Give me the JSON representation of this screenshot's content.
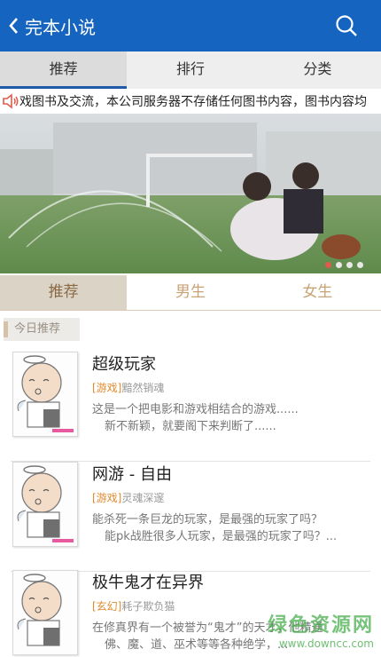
{
  "header": {
    "title": "完本小说",
    "back_icon": "chevron-left-icon",
    "search_icon": "search-icon",
    "bg_color": "#1565c0"
  },
  "main_tabs": [
    {
      "label": "推荐",
      "active": true
    },
    {
      "label": "排行",
      "active": false
    },
    {
      "label": "分类",
      "active": false
    }
  ],
  "notice": {
    "icon": "speaker-icon",
    "text": "戏图书及交流，本公司服务器不存储任何图书内容，图书内容均"
  },
  "banner": {
    "slide_count": 4,
    "active_slide": 1
  },
  "sub_tabs": [
    {
      "label": "推荐",
      "active": true
    },
    {
      "label": "男生",
      "active": false
    },
    {
      "label": "女生",
      "active": false
    }
  ],
  "section": {
    "label": "今日推荐"
  },
  "books": [
    {
      "title": "超级玩家",
      "genre": "[游戏]",
      "author": "黯然销魂",
      "desc1": "这是一个把电影和游戏相结合的游戏......",
      "desc2": "新不新颖，就要阁下来判断了......"
    },
    {
      "title": "网游 - 自由",
      "genre": "[游戏]",
      "author": "灵魂深邃",
      "desc1": "能杀死一条巨龙的玩家，是最强的玩家了吗？",
      "desc2": "能pk战胜很多人玩家，是最强的玩家了吗？..."
    },
    {
      "title": "极牛鬼才在异界",
      "genre": "[玄幻]",
      "author": "耗子欺负猫",
      "desc1": "在修真界有一个被誉为“鬼才”的天才，他精通",
      "desc2": "佛、魔、道、巫术等等各种绝学，..."
    }
  ],
  "watermark": {
    "main": "绿色资源网",
    "url": "www.downcc.com"
  }
}
